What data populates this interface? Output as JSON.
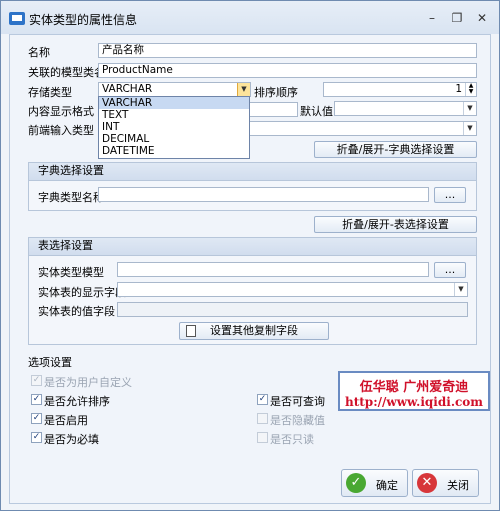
{
  "window": {
    "title": "实体类型的属性信息",
    "minimize": "–",
    "restore": "❐",
    "close": "✕"
  },
  "form": {
    "name_label": "名称",
    "name_value": "产品名称",
    "model_label": "关联的模型类名",
    "model_value": "ProductName",
    "storage_label": "存储类型",
    "storage_value": "VARCHAR",
    "sort_label": "排序顺序",
    "sort_value": "1",
    "display_label": "内容显示格式",
    "default_label": "默认值",
    "frontend_label": "前端输入类型",
    "dict_toggle": "折叠/展开-字典选择设置",
    "table_toggle": "折叠/展开-表选择设置"
  },
  "storage_options": [
    "VARCHAR",
    "TEXT",
    "INT",
    "DECIMAL",
    "DATETIME"
  ],
  "dict_group": {
    "title": "字典选择设置",
    "type_label": "字典类型名称",
    "browse": "..."
  },
  "table_group": {
    "title": "表选择设置",
    "model_label": "实体类型模型",
    "browse": "...",
    "display_field_label": "实体表的显示字段",
    "value_field_label": "实体表的值字段",
    "copy_button": "设置其他复制字段"
  },
  "options": {
    "title": "选项设置",
    "items": [
      {
        "label": "是否为用户自定义",
        "checked": true,
        "disabled": true
      },
      {
        "label": "是否允许排序",
        "checked": true,
        "disabled": false
      },
      {
        "label": "是否启用",
        "checked": true,
        "disabled": false
      },
      {
        "label": "是否为必填",
        "checked": true,
        "disabled": false
      },
      {
        "label": "是否可查询",
        "checked": true,
        "disabled": false
      },
      {
        "label": "是否隐藏值",
        "checked": false,
        "disabled": true
      },
      {
        "label": "是否只读",
        "checked": false,
        "disabled": true
      }
    ]
  },
  "watermark": {
    "line1": "伍华聪 广州爱奇迪",
    "line2": "http://www.iqidi.com"
  },
  "buttons": {
    "ok": "确定",
    "close": "关闭"
  },
  "colors": {
    "ok_green": "#49a832",
    "close_red": "#d7363a",
    "accent_blue": "#2d73c8"
  }
}
